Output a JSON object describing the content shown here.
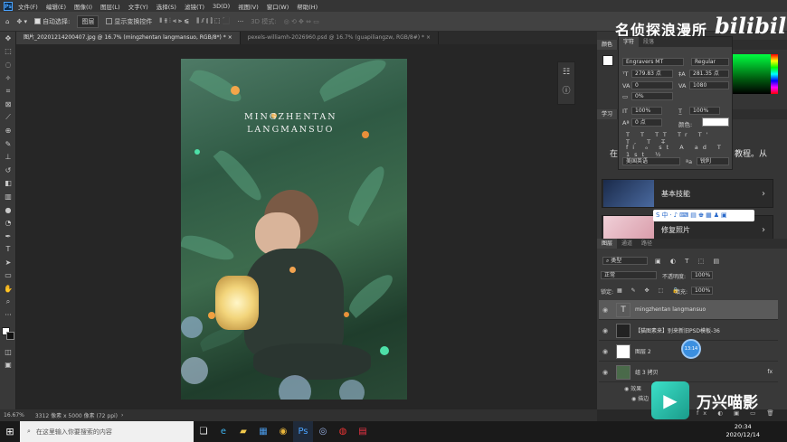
{
  "menubar": {
    "items": [
      "文件(F)",
      "编辑(E)",
      "图像(I)",
      "图层(L)",
      "文字(Y)",
      "选择(S)",
      "滤镜(T)",
      "3D(D)",
      "视图(V)",
      "窗口(W)",
      "帮助(H)"
    ]
  },
  "options": {
    "auto_select_label": "自动选择:",
    "auto_select_value": "图层",
    "show_transform_label": "显示变换控件",
    "mode_3d_label": "3D 模式:"
  },
  "tabs": [
    {
      "label": "图片_20201214200407.jpg @ 16.7% (mingzhentan langmansuo, RGB/8*) *"
    },
    {
      "label": "pexels-williamh-2026960.psd @ 16.7% (guapiliangzw, RGB/8#) *"
    }
  ],
  "photo": {
    "title_line1": "MINGZHENTAN",
    "title_line2": "LANGMANSUO"
  },
  "statusbar": {
    "zoom": "16.67%",
    "doc_info": "3312 像素 x 5000 像素 (72 ppi)"
  },
  "watermark": {
    "text": "名侦探浪漫所",
    "bili": "bilibili"
  },
  "character": {
    "tabs": [
      "字符",
      "段落"
    ],
    "font_family": "Engravers MT",
    "font_style": "Regular",
    "size": "279.83 点",
    "leading": "281.35 点",
    "kerning": "0",
    "tracking": "1080",
    "scale_pct": "0%",
    "vscale": "100%",
    "hscale": "100%",
    "baseline": "0 点",
    "color_label": "颜色:",
    "language": "美国英语",
    "aa": "锐利"
  },
  "panels": {
    "color_tab": "颜色",
    "learn_tab": "学习",
    "learn_text": "在",
    "learn_text2": "教程。从",
    "card1": "基本技能",
    "card2": "修复照片"
  },
  "layers": {
    "tabs": [
      "图层",
      "通道",
      "路径"
    ],
    "kind_label": "类型",
    "blend_mode": "正常",
    "opacity_label": "不透明度:",
    "opacity_value": "100%",
    "lock_label": "锁定:",
    "fill_label": "填充:",
    "fill_value": "100%",
    "items": [
      {
        "name": "mingzhentan langmansuo",
        "type": "text"
      },
      {
        "name": "【猫图素来】别来新旧PSD模板-36",
        "type": "smart"
      },
      {
        "name": "图层 2",
        "type": "pixel"
      },
      {
        "name": "组 3 拷贝",
        "type": "group",
        "fx": "fx"
      },
      {
        "name": "效果",
        "type": "effect"
      },
      {
        "name": "描边",
        "type": "effect"
      }
    ]
  },
  "taskbar": {
    "search_placeholder": "在这里输入你要搜索的内容",
    "time": "20:34",
    "date": "2020/12/14"
  },
  "overlay": {
    "wanxing": "万兴喵影",
    "cursor_time": "13:14"
  }
}
